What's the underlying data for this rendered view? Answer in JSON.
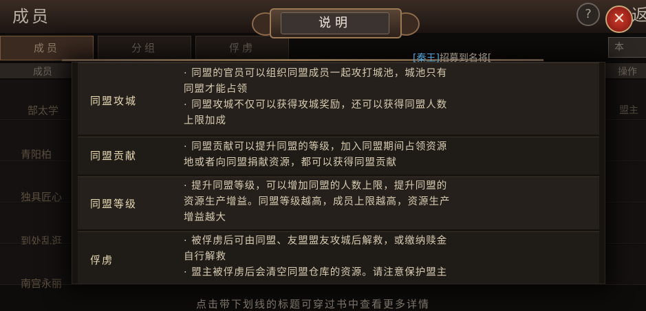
{
  "window": {
    "title": "成员",
    "help": "?",
    "close": "✕",
    "back": "返"
  },
  "tabs": [
    {
      "label": "成员",
      "active": true
    },
    {
      "label": "分组",
      "active": false
    },
    {
      "label": "俘虏",
      "active": false
    }
  ],
  "top_right_button": "本",
  "table_header": {
    "col1": "成员",
    "col2": "操作"
  },
  "background_rows": [
    {
      "name": "郜太学",
      "right": "盟主"
    },
    {
      "name": "青阳柏"
    },
    {
      "name": "独具匠心"
    },
    {
      "name": "到处乱逛"
    },
    {
      "name": "南宫永丽"
    }
  ],
  "recruit_msg": {
    "tag": "[秦王]",
    "text": "招募到名将["
  },
  "dialog": {
    "title": "说明",
    "rules": [
      {
        "name": "同盟攻城",
        "lines": [
          "· 同盟的官员可以组织同盟成员一起攻打城池，城池只有",
          "同盟才能占领",
          "· 同盟攻城不仅可以获得攻城奖励，还可以获得同盟人数",
          "上限加成"
        ]
      },
      {
        "name": "同盟贡献",
        "lines": [
          "· 同盟贡献可以提升同盟的等级，加入同盟期间占领资源",
          "地或者向同盟捐献资源，都可以获得同盟贡献"
        ]
      },
      {
        "name": "同盟等级",
        "lines": [
          "· 提升同盟等级，可以增加同盟的人数上限，提升同盟的",
          "资源生产增益。同盟等级越高，成员上限越高，资源生产",
          "增益越大"
        ]
      },
      {
        "name": "俘虏",
        "lines": [
          "· 被俘虏后可由同盟、友盟盟友攻城后解救，或缴纳赎金",
          "自行解救",
          "· 盟主被俘虏后会清空同盟仓库的资源。请注意保护盟主"
        ]
      }
    ]
  },
  "bottom_hint": "点击带下划线的标题可穿过书中查看更多详情"
}
